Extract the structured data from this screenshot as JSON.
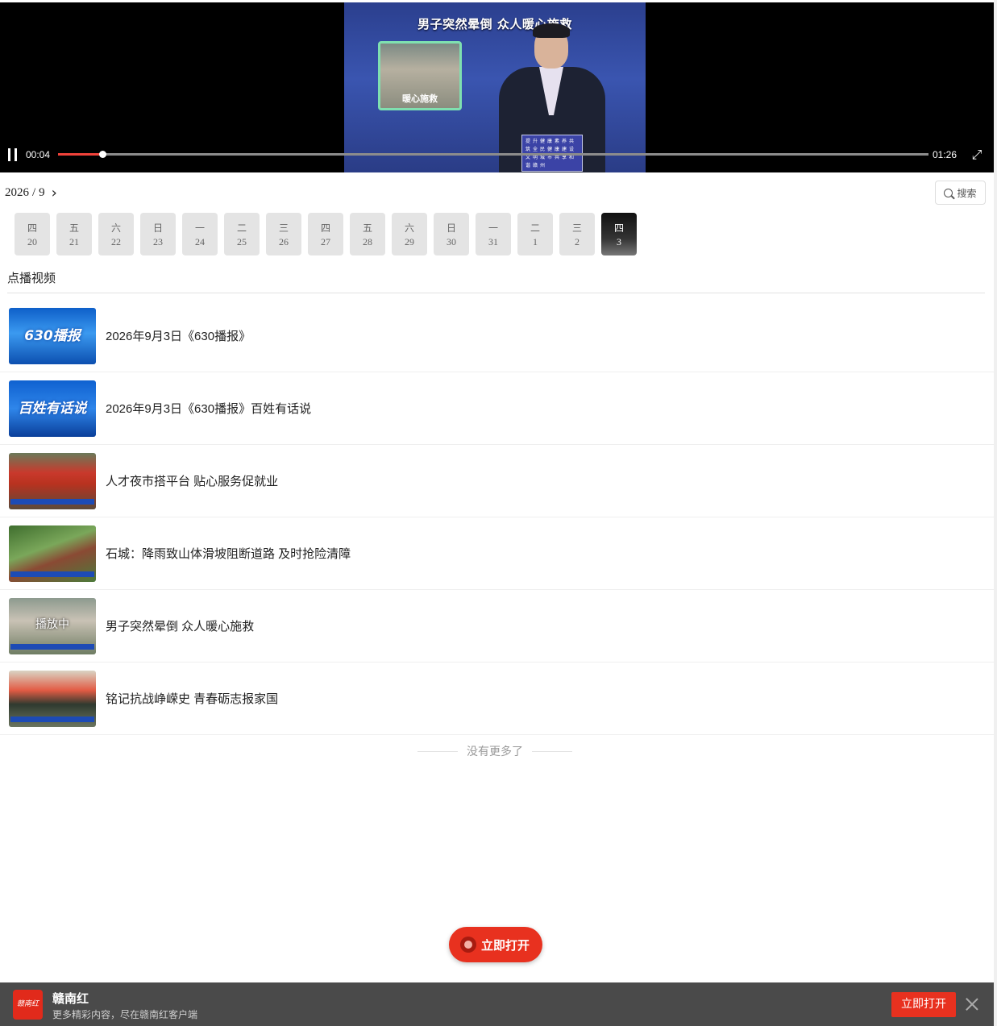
{
  "player": {
    "frame_title": "男子突然晕倒 众人暖心施救",
    "frame_inset_caption": "暖心施救",
    "frame_logo_text": "提升健康素养共筑全民健康建设文明城市共享和谐赣州",
    "current_time": "00:04",
    "duration": "01:26",
    "progress_fraction": 0.051,
    "state": "playing",
    "accent_color": "#f0423a",
    "icons": {
      "pause": "pause-icon",
      "fullscreen": "fullscreen-icon"
    }
  },
  "calendar": {
    "year": "2026",
    "separator": "/",
    "month": "9",
    "next_icon": "chevron-right-icon",
    "days": [
      {
        "weekday": "四",
        "day": "20"
      },
      {
        "weekday": "五",
        "day": "21"
      },
      {
        "weekday": "六",
        "day": "22"
      },
      {
        "weekday": "日",
        "day": "23"
      },
      {
        "weekday": "一",
        "day": "24"
      },
      {
        "weekday": "二",
        "day": "25"
      },
      {
        "weekday": "三",
        "day": "26"
      },
      {
        "weekday": "四",
        "day": "27"
      },
      {
        "weekday": "五",
        "day": "28"
      },
      {
        "weekday": "六",
        "day": "29"
      },
      {
        "weekday": "日",
        "day": "30"
      },
      {
        "weekday": "一",
        "day": "31"
      },
      {
        "weekday": "二",
        "day": "1"
      },
      {
        "weekday": "三",
        "day": "2"
      },
      {
        "weekday": "四",
        "day": "3"
      }
    ],
    "active_day": "3"
  },
  "search": {
    "label": "搜索",
    "icon": "search-icon"
  },
  "section": {
    "title": "点播视频"
  },
  "videos": [
    {
      "title": "2026年9月3日《630播报》",
      "thumb_text": "630播报",
      "playing": false
    },
    {
      "title": "2026年9月3日《630播报》百姓有话说",
      "thumb_text": "百姓有话说",
      "playing": false
    },
    {
      "title": "人才夜市搭平台 贴心服务促就业",
      "thumb_text": "",
      "playing": false
    },
    {
      "title": "石城：降雨致山体滑坡阻断道路 及时抢险清障",
      "thumb_text": "",
      "playing": false
    },
    {
      "title": "男子突然晕倒 众人暖心施救",
      "thumb_text": "播放中",
      "playing": true
    },
    {
      "title": "铭记抗战峥嵘史 青春砺志报家国",
      "thumb_text": "",
      "playing": false
    }
  ],
  "list_end": "没有更多了",
  "float_button": {
    "label": "立即打开"
  },
  "banner": {
    "logo_text": "赣南红",
    "app_name": "赣南红",
    "subtitle": "更多精彩内容，尽在赣南红客户端",
    "open_label": "立即打开",
    "close_icon": "close-icon",
    "brand_color": "#e8311f"
  }
}
